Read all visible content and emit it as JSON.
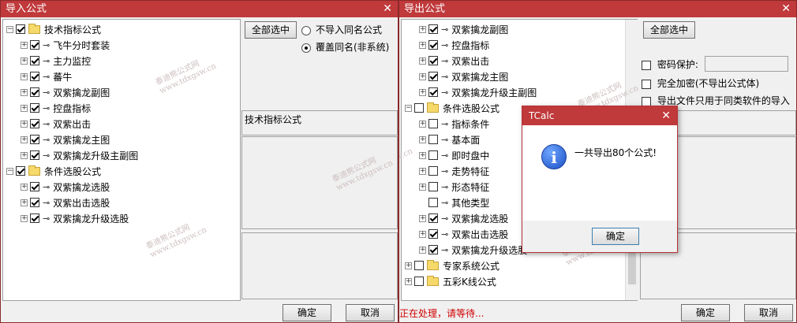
{
  "import_window": {
    "title": "导入公式",
    "select_all_label": "全部选中",
    "radio_options": [
      {
        "label": "不导入同名公式",
        "selected": false
      },
      {
        "label": "覆盖同名(非系统)",
        "selected": true
      }
    ],
    "panel_label": "技术指标公式",
    "ok_label": "确定",
    "cancel_label": "取消",
    "tree": [
      {
        "level": 0,
        "type": "folder",
        "label": "技术指标公式",
        "checked": true,
        "expander": "⊟"
      },
      {
        "level": 1,
        "type": "item",
        "label": "飞牛分时套装",
        "checked": true,
        "expander": "⊞"
      },
      {
        "level": 1,
        "type": "item",
        "label": "主力监控",
        "checked": true,
        "expander": "⊞"
      },
      {
        "level": 1,
        "type": "item",
        "label": "蕃牛",
        "checked": true,
        "expander": "⊞"
      },
      {
        "level": 1,
        "type": "item",
        "label": "双紫擒龙副图",
        "checked": true,
        "expander": "⊞"
      },
      {
        "level": 1,
        "type": "item",
        "label": "控盘指标",
        "checked": true,
        "expander": "⊞"
      },
      {
        "level": 1,
        "type": "item",
        "label": "双紫出击",
        "checked": true,
        "expander": "⊞"
      },
      {
        "level": 1,
        "type": "item",
        "label": "双紫擒龙主图",
        "checked": true,
        "expander": "⊞"
      },
      {
        "level": 1,
        "type": "item",
        "label": "双紫擒龙升级主副图",
        "checked": true,
        "expander": "⊞"
      },
      {
        "level": 0,
        "type": "folder",
        "label": "条件选股公式",
        "checked": true,
        "expander": "⊟"
      },
      {
        "level": 1,
        "type": "item",
        "label": "双紫擒龙选股",
        "checked": true,
        "expander": "⊞"
      },
      {
        "level": 1,
        "type": "item",
        "label": "双紫出击选股",
        "checked": true,
        "expander": "⊞"
      },
      {
        "level": 1,
        "type": "item",
        "label": "双紫擒龙升级选股",
        "checked": true,
        "expander": "⊞"
      }
    ]
  },
  "export_window": {
    "title": "导出公式",
    "select_all_label": "全部选中",
    "password_label": "密码保护:",
    "full_encrypt_label": "完全加密(不导出公式体)",
    "same_software_label": "导出文件只用于同类软件的导入",
    "processing_text": "正在处理，请等待...",
    "ok_label": "确定",
    "cancel_label": "取消",
    "tree": [
      {
        "level": 1,
        "type": "item",
        "label": "双紫擒龙副图",
        "checked": true,
        "expander": "⊞"
      },
      {
        "level": 1,
        "type": "item",
        "label": "控盘指标",
        "checked": true,
        "expander": "⊞"
      },
      {
        "level": 1,
        "type": "item",
        "label": "双紫出击",
        "checked": true,
        "expander": "⊞"
      },
      {
        "level": 1,
        "type": "item",
        "label": "双紫擒龙主图",
        "checked": true,
        "expander": "⊞"
      },
      {
        "level": 1,
        "type": "item",
        "label": "双紫擒龙升级主副图",
        "checked": true,
        "expander": "⊞"
      },
      {
        "level": 0,
        "type": "folder",
        "label": "条件选股公式",
        "checked": false,
        "expander": "⊟"
      },
      {
        "level": 1,
        "type": "item",
        "label": "指标条件",
        "checked": false,
        "expander": "⊞"
      },
      {
        "level": 1,
        "type": "item",
        "label": "基本面",
        "checked": false,
        "expander": "⊞"
      },
      {
        "level": 1,
        "type": "item",
        "label": "即时盘中",
        "checked": false,
        "expander": "⊞"
      },
      {
        "level": 1,
        "type": "item",
        "label": "走势特征",
        "checked": false,
        "expander": "⊞"
      },
      {
        "level": 1,
        "type": "item",
        "label": "形态特征",
        "checked": false,
        "expander": "⊞"
      },
      {
        "level": 1,
        "type": "item",
        "label": "其他类型",
        "checked": false,
        "expander": ""
      },
      {
        "level": 1,
        "type": "item",
        "label": "双紫擒龙选股",
        "checked": true,
        "expander": "⊞"
      },
      {
        "level": 1,
        "type": "item",
        "label": "双紫出击选股",
        "checked": true,
        "expander": "⊞"
      },
      {
        "level": 1,
        "type": "item",
        "label": "双紫擒龙升级选股",
        "checked": true,
        "expander": "⊞"
      },
      {
        "level": 0,
        "type": "folder",
        "label": "专家系统公式",
        "checked": false,
        "expander": "⊞"
      },
      {
        "level": 0,
        "type": "folder",
        "label": "五彩K线公式",
        "checked": false,
        "expander": "⊞"
      }
    ]
  },
  "dialog": {
    "title": "TCalc",
    "message": "一共导出80个公式!",
    "ok_label": "确定"
  },
  "watermark": {
    "line1": "泰迪熊公式网",
    "line2": "www.tdxgsw.cn"
  },
  "colors": {
    "title_bar": "#c0393b",
    "processing_text": "#d00000"
  }
}
